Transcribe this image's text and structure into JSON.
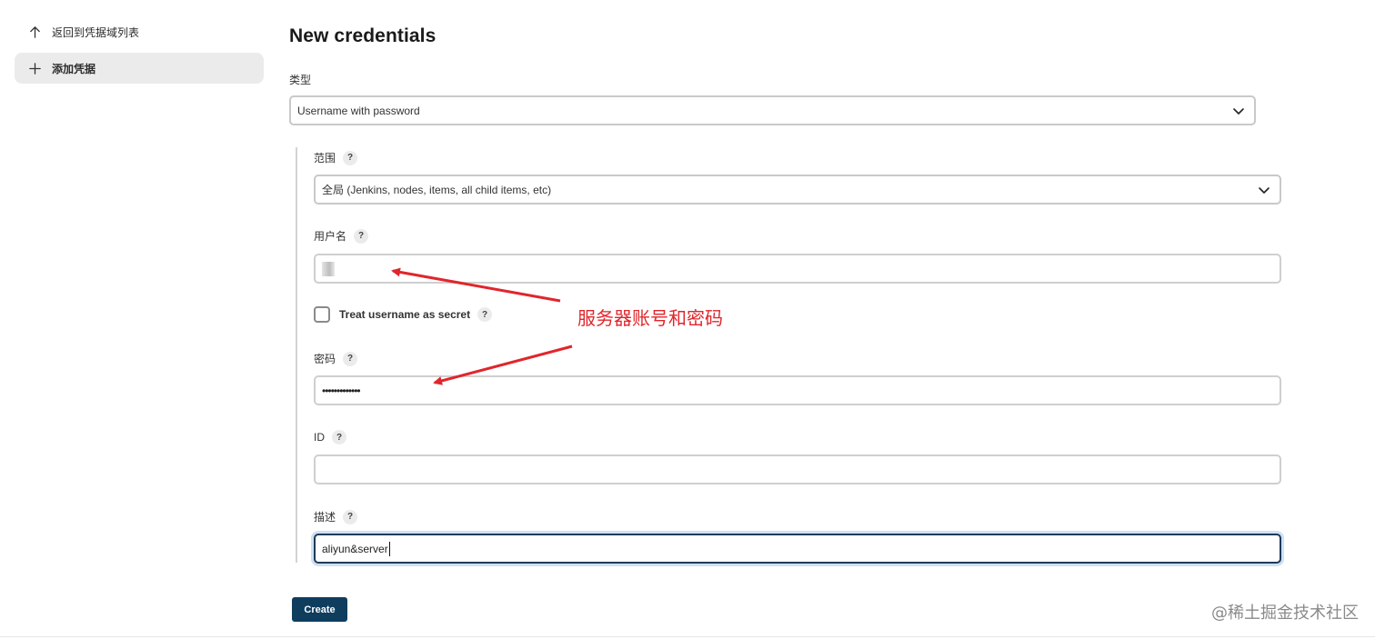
{
  "sidebar": {
    "items": [
      {
        "label": "返回到凭据域列表",
        "icon": "arrow-up-icon"
      },
      {
        "label": "添加凭据",
        "icon": "plus-icon"
      }
    ]
  },
  "main": {
    "title": "New credentials",
    "type_label": "类型",
    "type_value": "Username with password"
  },
  "form": {
    "scope_label": "范围",
    "scope_value": "全局 (Jenkins, nodes, items, all child items, etc)",
    "username_label": "用户名",
    "treat_secret_label": "Treat username as secret",
    "password_label": "密码",
    "password_value": "•••••••••••••",
    "id_label": "ID",
    "id_value": "",
    "description_label": "描述",
    "description_value": "aliyun&server",
    "help_glyph": "?"
  },
  "actions": {
    "create_label": "Create"
  },
  "annotation": {
    "text": "服务器账号和密码",
    "color": "#e0262c"
  },
  "watermark": "@稀土掘金技术社区",
  "colors": {
    "primary_button": "#0f3d5e",
    "focus_border": "#1e3a5a"
  }
}
